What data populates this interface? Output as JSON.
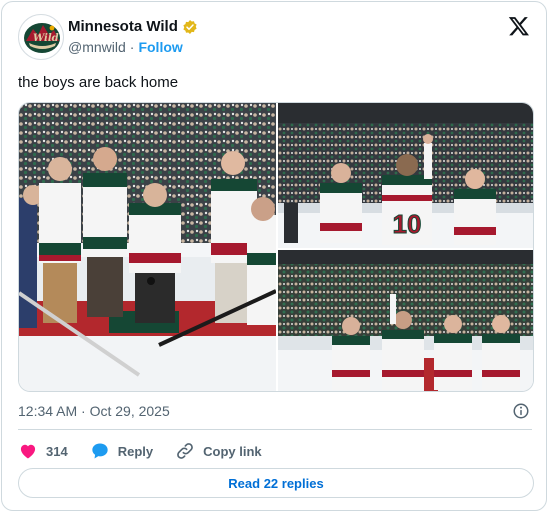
{
  "author": {
    "name": "Minnesota Wild",
    "handle": "@mnwild",
    "separator": "·",
    "follow_label": "Follow"
  },
  "tweet": {
    "text": "the boys are back home",
    "timestamp": "12:34 AM · Oct 29, 2025"
  },
  "media": {
    "photos": [
      {
        "description": "ceremonial-puck-drop",
        "jersey_number": ""
      },
      {
        "description": "players-applauding-number-10",
        "jersey_number": "10"
      },
      {
        "description": "four-players-on-ice",
        "jersey_number": ""
      }
    ]
  },
  "actions": {
    "like_count": "314",
    "reply_label": "Reply",
    "copy_link_label": "Copy link"
  },
  "read_replies_label": "Read 22 replies",
  "colors": {
    "accent": "#1d9bf0",
    "like": "#f91880",
    "wild_green": "#154734",
    "wild_red": "#a6192e",
    "wild_cream": "#eeeeee",
    "verified_gold": "#e2b719"
  }
}
